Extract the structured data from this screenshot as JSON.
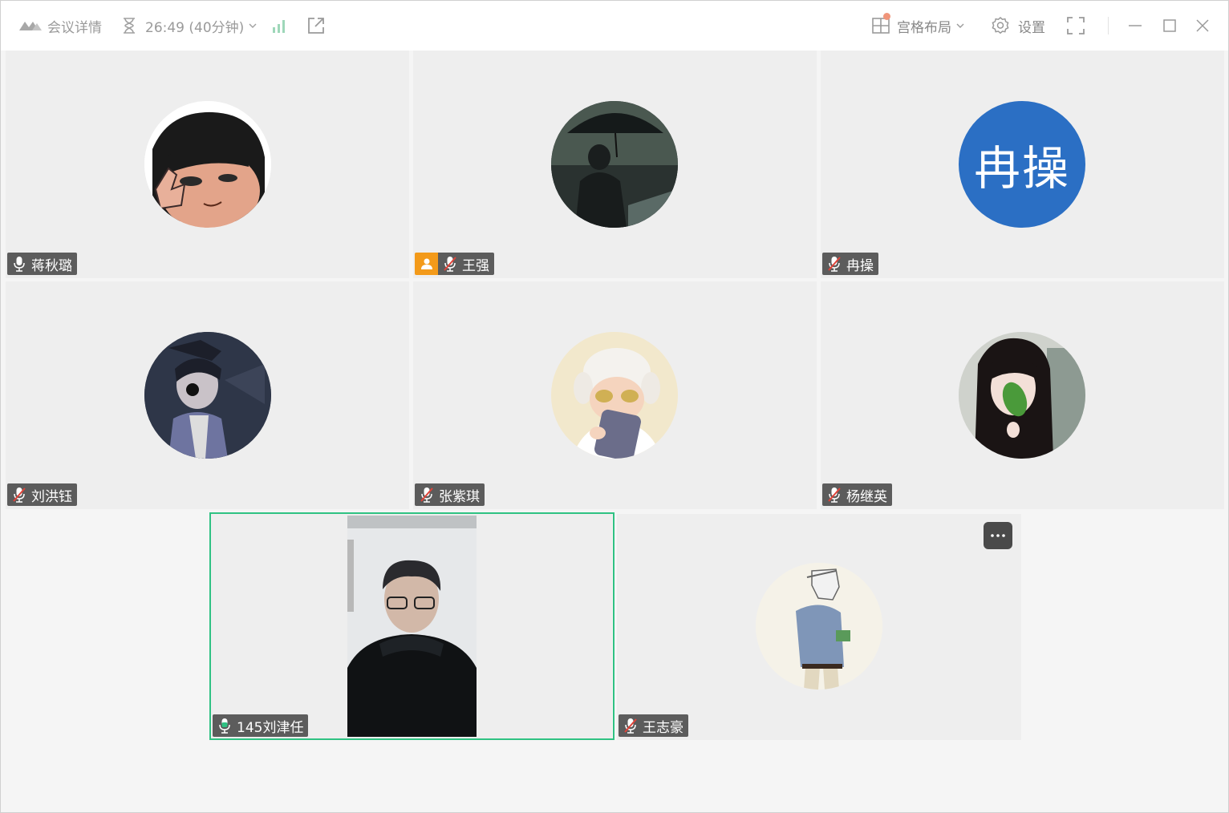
{
  "topbar": {
    "meeting_details_label": "会议详情",
    "timer_label": "26:49 (40分钟)",
    "layout_label": "宫格布局",
    "settings_label": "设置"
  },
  "participants": [
    {
      "name": "蒋秋璐",
      "mic": "on"
    },
    {
      "name": "王强",
      "mic": "muted",
      "host": true
    },
    {
      "name": "冉操",
      "mic": "muted",
      "avatar_text": "冉操",
      "avatar_color": "#2b6fc4"
    },
    {
      "name": "刘洪钰",
      "mic": "muted"
    },
    {
      "name": "张紫琪",
      "mic": "muted"
    },
    {
      "name": "杨继英",
      "mic": "muted"
    },
    {
      "name": "145刘津任",
      "mic": "speaking",
      "video": true,
      "active": true
    },
    {
      "name": "王志豪",
      "mic": "muted"
    }
  ],
  "colors": {
    "active_border": "#2fc283",
    "host_badge": "#f39a1a",
    "muted_slash": "#e0443a",
    "speaking_mic": "#2fc283"
  },
  "icons": [
    "logo-icon",
    "hourglass-icon",
    "chevron-down-icon",
    "signal-icon",
    "share-external-icon",
    "grid-layout-icon",
    "gear-icon",
    "fullscreen-icon",
    "minimize-icon",
    "maximize-icon",
    "close-icon",
    "mic-icon",
    "mic-muted-icon",
    "host-person-icon",
    "more-icon"
  ]
}
